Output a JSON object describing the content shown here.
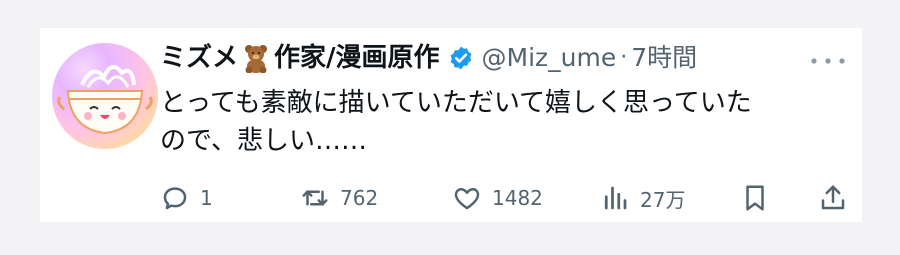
{
  "tweet": {
    "author_name": "ミズメ",
    "author_name_suffix": "作家/漫画原作",
    "name_emoji": "teddy-bear-icon",
    "verified_icon": "verified-badge-icon",
    "handle": "@Miz_ume",
    "separator": "·",
    "time": "7時間",
    "more_icon": "more-icon",
    "text_lines": [
      "とっても素敵に描いていただいて嬉しく思っていた",
      "ので、悲しい……"
    ]
  },
  "actions": {
    "reply": {
      "icon": "reply-icon",
      "count": "1"
    },
    "retweet": {
      "icon": "retweet-icon",
      "count": "762"
    },
    "like": {
      "icon": "like-icon",
      "count": "1482"
    },
    "views": {
      "icon": "views-icon",
      "count": "27万"
    },
    "bookmark": {
      "icon": "bookmark-icon"
    },
    "share": {
      "icon": "share-icon"
    }
  },
  "colors": {
    "verified_blue": "#1d9bf0",
    "text_primary": "#0f1419",
    "text_secondary": "#536471"
  }
}
